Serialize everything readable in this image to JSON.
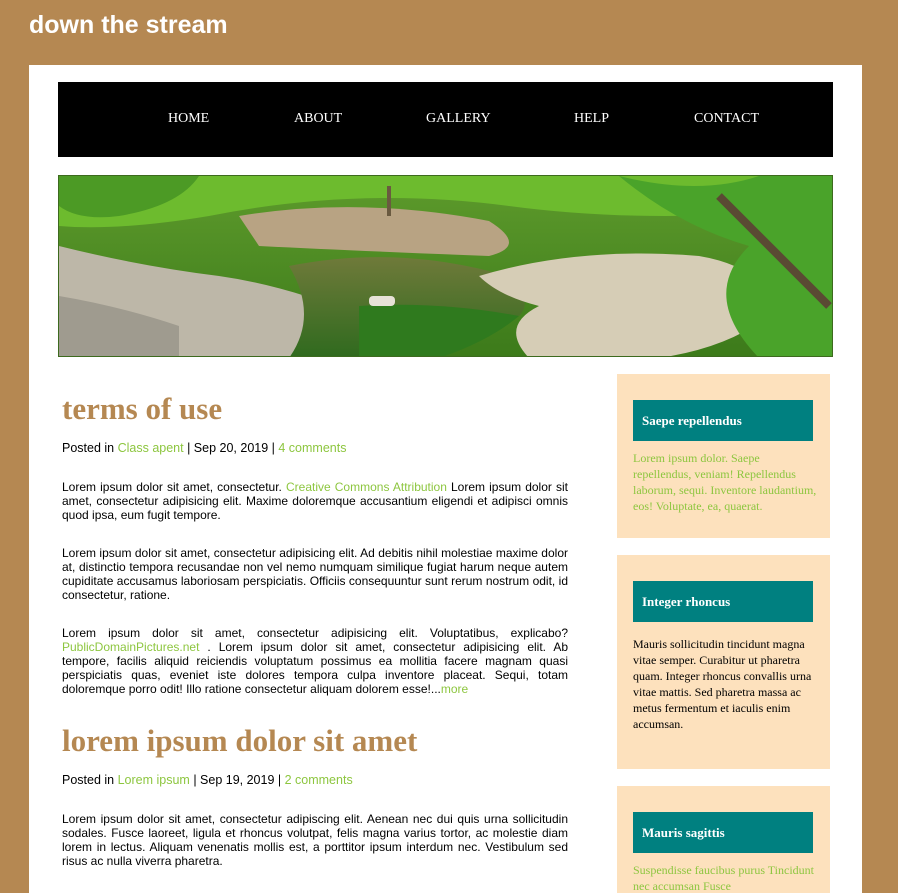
{
  "site": {
    "title": "down the stream"
  },
  "nav": {
    "items": [
      "HOME",
      "ABOUT",
      "GALLERY",
      "HELP",
      "CONTACT"
    ]
  },
  "banner": {
    "alt": ""
  },
  "posts": [
    {
      "title": "terms of use",
      "meta": {
        "prefix": "Posted in ",
        "category": "Class apent",
        "date": " | Sep 20, 2019 | ",
        "comments": "4 comments"
      },
      "paragraphs": [
        {
          "before": "Lorem ipsum dolor sit amet, consectetur. ",
          "link": "Creative Commons Attribution",
          "after": " Lorem ipsum dolor sit amet, consectetur adipisicing elit. Maxime doloremque accusantium eligendi et adipisci omnis quod ipsa, eum fugit tempore."
        },
        {
          "text": "Lorem ipsum dolor sit amet, consectetur adipisicing elit. Ad debitis nihil molestiae maxime dolor at, distinctio tempora recusandae non vel nemo numquam similique fugiat harum neque autem cupiditate accusamus laboriosam perspiciatis. Officiis consequuntur sunt rerum nostrum odit, id consectetur, ratione."
        },
        {
          "before": "Lorem ipsum dolor sit amet, consectetur adipisicing elit. Voluptatibus, explicabo? ",
          "link": "PublicDomainPictures.net",
          "after": " . Lorem ipsum dolor sit amet, consectetur adipisicing elit. Ab tempore, facilis aliquid reiciendis voluptatum possimus ea mollitia facere magnam quasi perspiciatis quas, eveniet iste dolores tempora culpa inventore placeat. Sequi, totam doloremque porro odit! Illo ratione consectetur aliquam dolorem esse!...",
          "more": "more"
        }
      ]
    },
    {
      "title": "lorem ipsum dolor sit amet",
      "meta": {
        "prefix": "Posted in ",
        "category": "Lorem ipsum",
        "date": " | Sep 19, 2019 | ",
        "comments": "2 comments"
      },
      "paragraphs": [
        {
          "text": "Lorem ipsum dolor sit amet, consectetur adipiscing elit. Aenean nec dui quis urna sollicitudin sodales. Fusce laoreet, ligula et rhoncus volutpat, felis magna varius tortor, ac molestie diam lorem in lectus. Aliquam venenatis mollis est, a porttitor ipsum interdum nec. Vestibulum sed risus ac nulla viverra pharetra."
        }
      ]
    }
  ],
  "sidebar": [
    {
      "title": "Saepe repellendus",
      "text": "Lorem ipsum dolor. Saepe repellendus, veniam! Repellendus laborum, sequi. Inventore laudantium, eos! Voluptate, ea, quaerat."
    },
    {
      "title": "Integer rhoncus",
      "text": "Mauris sollicitudin tincidunt magna vitae semper. Curabitur ut pharetra quam. Integer rhoncus convallis urna vitae mattis. Sed pharetra massa ac metus fermentum et iaculis enim accumsan."
    },
    {
      "title": "Mauris sagittis",
      "text": "Suspendisse faucibus purus Tincidunt nec accumsan Fusce"
    }
  ],
  "colors": {
    "background": "#b58852",
    "accent": "#8dc63f",
    "widget_head": "#008080",
    "widget_bg": "#fde1bd",
    "nav": "#000000"
  }
}
